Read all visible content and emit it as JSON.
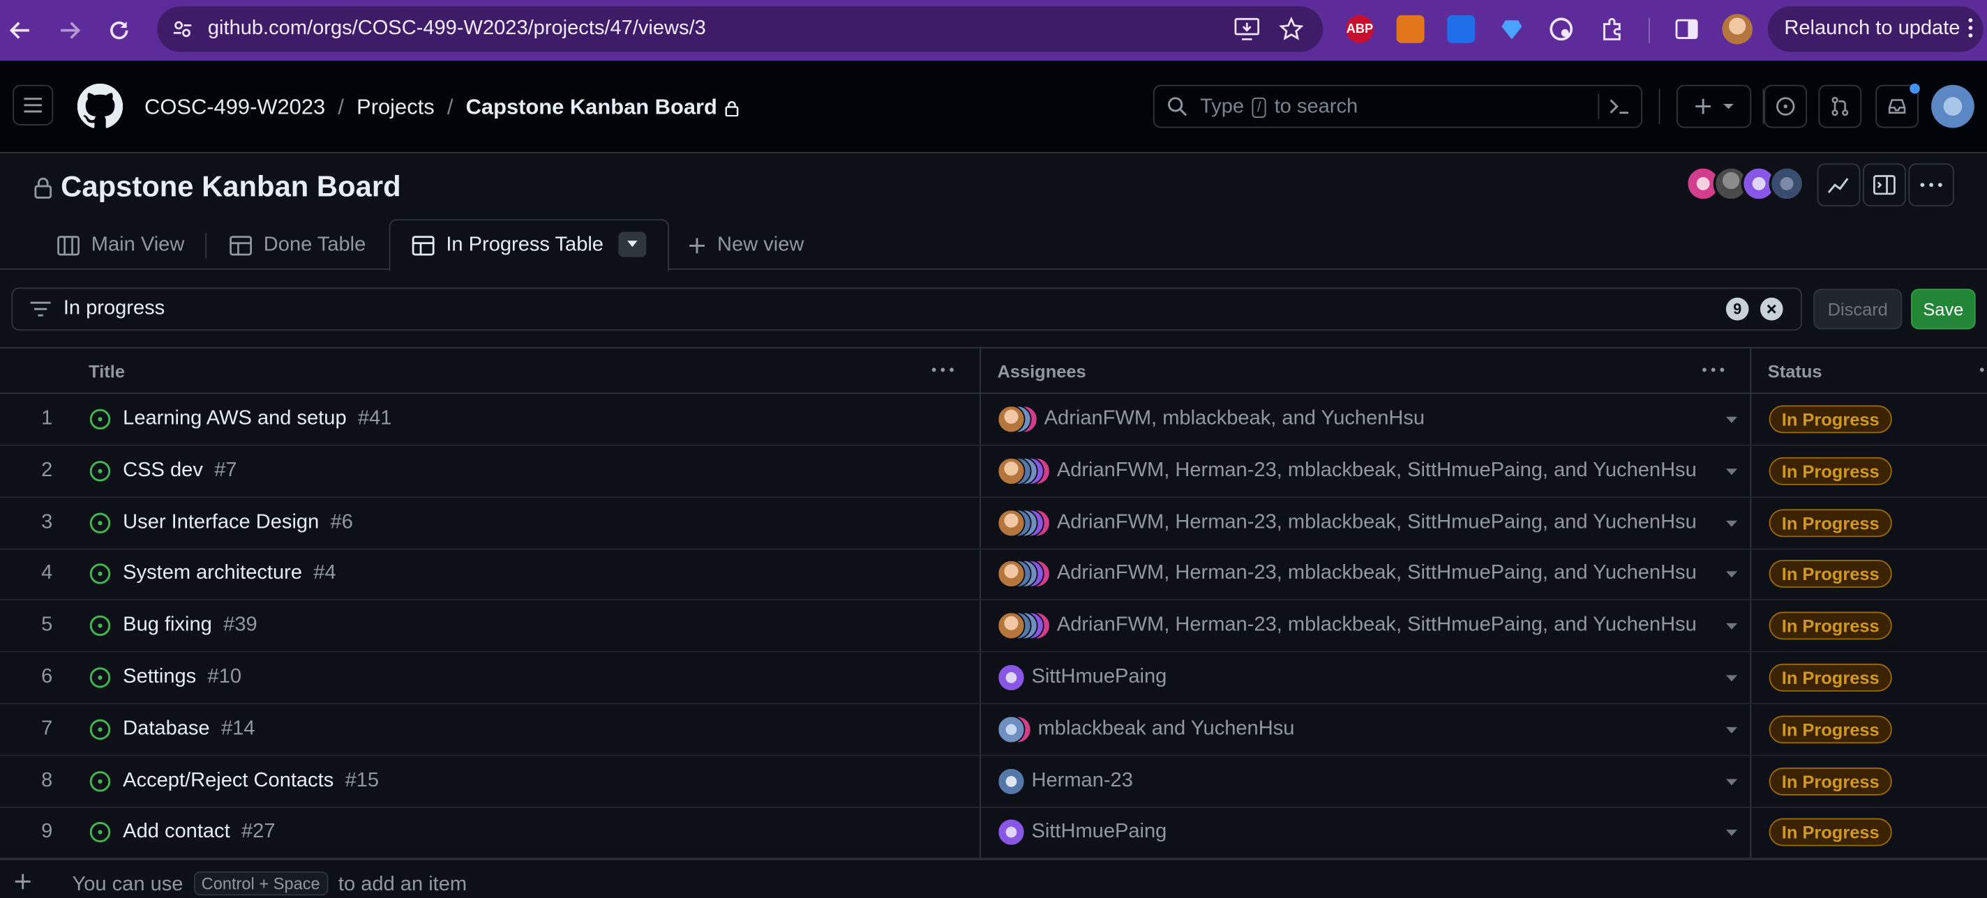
{
  "browser": {
    "url": "github.com/orgs/COSC-499-W2023/projects/47/views/3",
    "relaunch_label": "Relaunch to update",
    "extensions": [
      "ABP"
    ]
  },
  "header": {
    "breadcrumbs": {
      "org": "COSC-499-W2023",
      "section": "Projects",
      "project": "Capstone Kanban Board",
      "separator": "/"
    },
    "search": {
      "prefix": "Type",
      "key": "/",
      "suffix": "to search"
    }
  },
  "project": {
    "title": "Capstone Kanban Board"
  },
  "tabs": [
    {
      "label": "Main View",
      "icon": "board-icon"
    },
    {
      "label": "Done Table",
      "icon": "table-icon"
    },
    {
      "label": "In Progress Table",
      "icon": "table-icon",
      "active": true
    }
  ],
  "new_view_label": "New view",
  "filter": {
    "query": "In progress",
    "count": "9"
  },
  "buttons": {
    "discard": "Discard",
    "save": "Save"
  },
  "table": {
    "columns": {
      "title": "Title",
      "assignees": "Assignees",
      "status": "Status"
    },
    "rows": [
      {
        "num": "1",
        "title": "Learning AWS and setup",
        "issue": "#41",
        "assignees": "AdrianFWM, mblackbeak, and YuchenHsu",
        "status": "In Progress"
      },
      {
        "num": "2",
        "title": "CSS dev",
        "issue": "#7",
        "assignees": "AdrianFWM, Herman-23, mblackbeak, SittHmuePaing, and YuchenHsu",
        "status": "In Progress"
      },
      {
        "num": "3",
        "title": "User Interface Design",
        "issue": "#6",
        "assignees": "AdrianFWM, Herman-23, mblackbeak, SittHmuePaing, and YuchenHsu",
        "status": "In Progress"
      },
      {
        "num": "4",
        "title": "System architecture",
        "issue": "#4",
        "assignees": "AdrianFWM, Herman-23, mblackbeak, SittHmuePaing, and YuchenHsu",
        "status": "In Progress"
      },
      {
        "num": "5",
        "title": "Bug fixing",
        "issue": "#39",
        "assignees": "AdrianFWM, Herman-23, mblackbeak, SittHmuePaing, and YuchenHsu",
        "status": "In Progress"
      },
      {
        "num": "6",
        "title": "Settings",
        "issue": "#10",
        "assignees": "SittHmuePaing",
        "status": "In Progress"
      },
      {
        "num": "7",
        "title": "Database",
        "issue": "#14",
        "assignees": "mblackbeak and YuchenHsu",
        "status": "In Progress"
      },
      {
        "num": "8",
        "title": "Accept/Reject Contacts",
        "issue": "#15",
        "assignees": "Herman-23",
        "status": "In Progress"
      },
      {
        "num": "9",
        "title": "Add contact",
        "issue": "#27",
        "assignees": "SittHmuePaing",
        "status": "In Progress"
      }
    ]
  },
  "add_item": {
    "prefix": "You can use",
    "shortcut": "Control + Space",
    "suffix": "to add an item"
  },
  "colors": {
    "chrome": "#5e2b9a",
    "header_bg": "#010409",
    "page_bg": "#0d1117",
    "status_text": "#d29922",
    "open_issue": "#3fb950",
    "save_green": "#238636"
  }
}
